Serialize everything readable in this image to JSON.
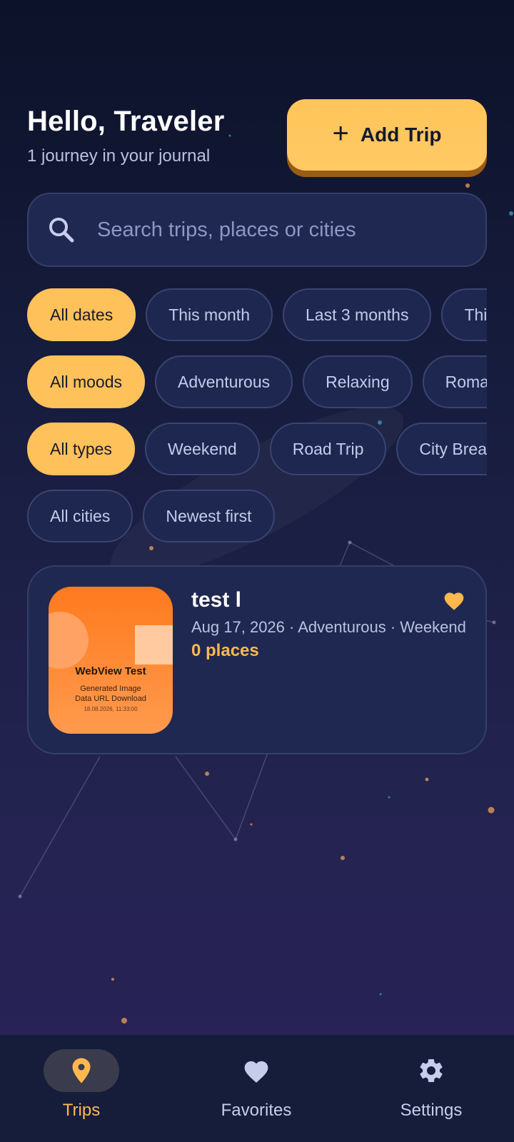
{
  "header": {
    "greeting": "Hello, Traveler",
    "subtitle": "1 journey in your journal",
    "add_trip_label": "Add Trip"
  },
  "search": {
    "icon": "search-icon",
    "placeholder": "Search trips, places or cities",
    "value": ""
  },
  "filters": {
    "dates": [
      "All dates",
      "This month",
      "Last 3 months",
      "This year"
    ],
    "moods": [
      "All moods",
      "Adventurous",
      "Relaxing",
      "Romantic"
    ],
    "types": [
      "All types",
      "Weekend",
      "Road Trip",
      "City Break"
    ],
    "sort": [
      "All cities",
      "Newest first"
    ]
  },
  "trips": [
    {
      "title": "test l",
      "meta": "Aug 17, 2026 · Adventurous · Weekend",
      "places": "0 places",
      "favorite": true,
      "thumbnail": {
        "title": "WebView Test",
        "line1": "Generated Image",
        "line2": "Data URL Download",
        "line3": "18.08.2026, 11:33:00"
      }
    }
  ],
  "nav": {
    "items": [
      {
        "label": "Trips",
        "icon": "location-pin-icon",
        "active": true
      },
      {
        "label": "Favorites",
        "icon": "heart-icon",
        "active": false
      },
      {
        "label": "Settings",
        "icon": "gear-icon",
        "active": false
      }
    ]
  },
  "colors": {
    "accent": "#ffc15a",
    "accent_text": "#ffb84e",
    "card_bg": "#1f2850",
    "background_top": "#0c1229",
    "background_bottom": "#2a2258"
  }
}
